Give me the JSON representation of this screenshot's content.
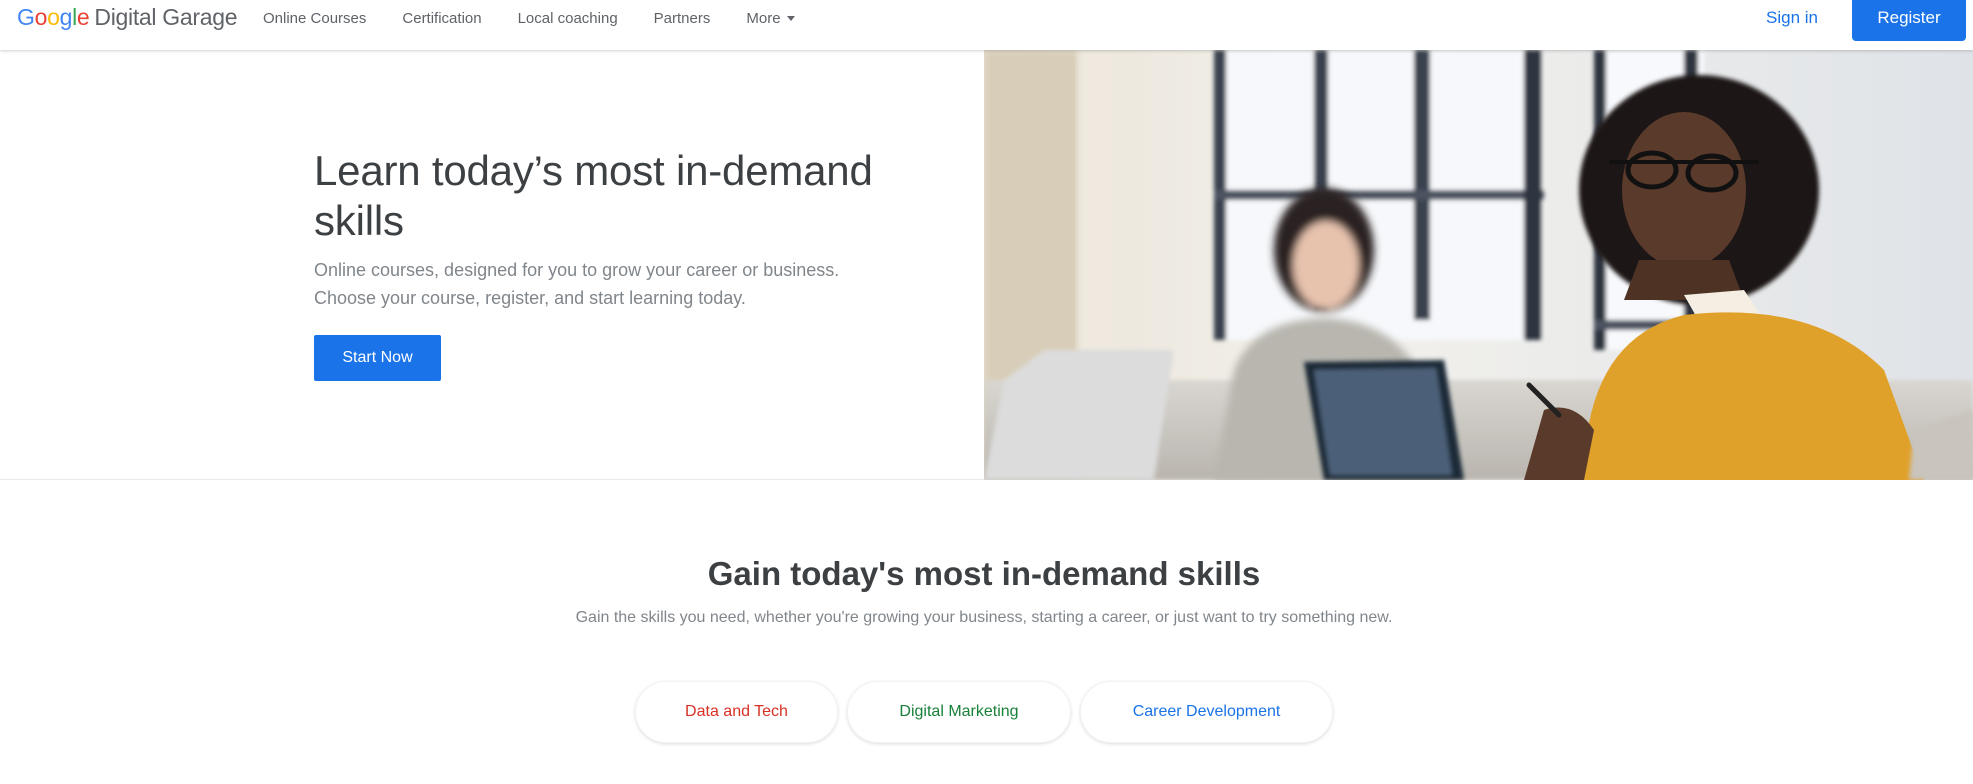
{
  "header": {
    "logo": {
      "google": [
        "G",
        "o",
        "o",
        "g",
        "l",
        "e"
      ],
      "product": "Digital Garage"
    },
    "nav": [
      "Online Courses",
      "Certification",
      "Local coaching",
      "Partners",
      "More"
    ],
    "signin_label": "Sign in",
    "register_label": "Register"
  },
  "hero": {
    "title": "Learn today’s most in-demand skills",
    "subtitle_line1": "Online courses, designed for you to grow your career or business.",
    "subtitle_line2": "Choose your course, register, and start learning today.",
    "cta_label": "Start Now",
    "image": "photo-two-women-at-table-with-laptops"
  },
  "skills": {
    "title": "Gain today's most in-demand skills",
    "subtitle": "Gain the skills you need, whether you're growing your business, starting a career, or just want to try something new.",
    "categories": [
      {
        "label": "Data and Tech",
        "color": "#d93025"
      },
      {
        "label": "Digital Marketing",
        "color": "#188038"
      },
      {
        "label": "Career Development",
        "color": "#1a73e8"
      }
    ]
  },
  "colors": {
    "brand_blue": "#1a73e8",
    "text_gray": "#80868b",
    "heading": "#3c4043"
  }
}
